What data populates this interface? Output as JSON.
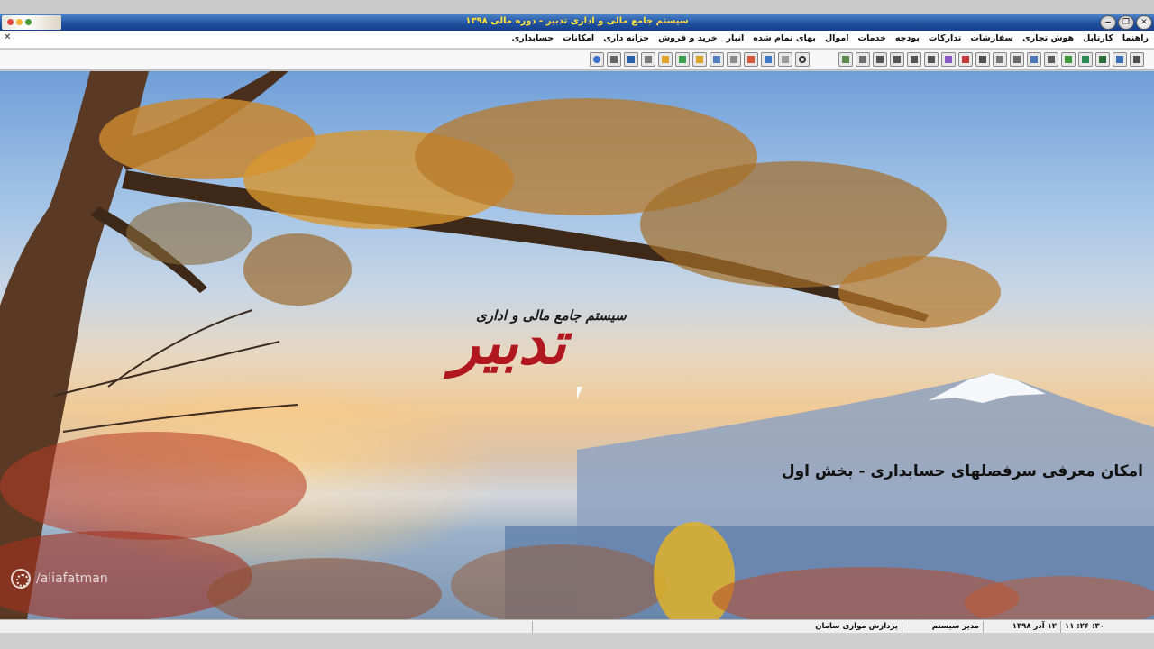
{
  "window": {
    "title": "سیستم جامع مالی و اداری تدبیر - دوره مالی ۱۳۹۸",
    "buttons": {
      "minimize": "‒",
      "restore": "❐",
      "close": "✕"
    }
  },
  "menu": {
    "items": [
      "حسابداری",
      "امکانات",
      "خزانه داری",
      "خرید و فروش",
      "انبار",
      "بهای تمام شده",
      "اموال",
      "خدمات",
      "بودجه",
      "تدارکات",
      "سفارشات",
      "هوش تجاری",
      "کارتابل",
      "راهنما"
    ],
    "close_glyph": "✕"
  },
  "splash": {
    "logo_subtitle": "سیستم جامع مالی و اداری",
    "logo_title": "تدبیر",
    "overlay_caption": "امکان معرفی سرفصلهای حسابداری - بخش اول",
    "watermark": "/aliafatman"
  },
  "status": {
    "time": "۱۱ :۲۶ :۳۰",
    "date": "۱۲ آذر ۱۳۹۸",
    "user": "مدیر سیستم",
    "company": "پردازش موازی سامان"
  },
  "colors": {
    "title_bar": "#1d4f9c",
    "title_text": "#ffe23a",
    "logo_red": "#b0171f"
  }
}
